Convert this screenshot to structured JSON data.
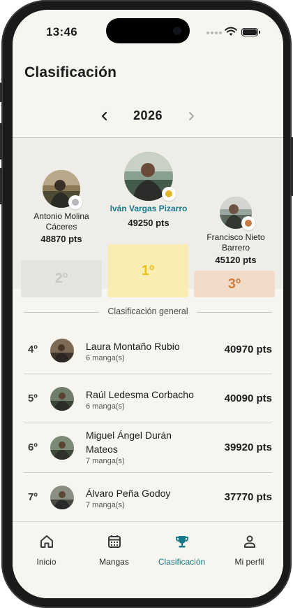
{
  "status_bar": {
    "time": "13:46"
  },
  "header": {
    "title": "Clasificación"
  },
  "year_selector": {
    "year": "2026"
  },
  "podium": [
    {
      "place_label": "2º",
      "name": "Antonio Molina Cáceres",
      "points": "48870 pts",
      "medal": "silver-medal-icon",
      "block_color": "#e6e4e0",
      "label_color": "#c9c8c4"
    },
    {
      "place_label": "1º",
      "name": "Iván Vargas Pizarro",
      "points": "49250 pts",
      "medal": "gold-medal-icon",
      "block_color": "#f9edb4",
      "label_color": "#e6c21e"
    },
    {
      "place_label": "3º",
      "name": "Francisco Nieto Barrero",
      "points": "45120 pts",
      "medal": "bronze-medal-icon",
      "block_color": "#f1dcca",
      "label_color": "#d0803c"
    }
  ],
  "general": {
    "section_title": "Clasificación general",
    "rows": [
      {
        "rank": "4º",
        "name": "Laura Montaño Rubio",
        "sub": "6 manga(s)",
        "points": "40970 pts"
      },
      {
        "rank": "5º",
        "name": "Raúl Ledesma Corbacho",
        "sub": "6 manga(s)",
        "points": "40090 pts"
      },
      {
        "rank": "6º",
        "name": "Miguel Ángel Durán Mateos",
        "sub": "7 manga(s)",
        "points": "39920 pts"
      },
      {
        "rank": "7º",
        "name": "Álvaro Peña Godoy",
        "sub": "7 manga(s)",
        "points": "37770 pts"
      }
    ]
  },
  "tabs": [
    {
      "label": "Inicio",
      "icon": "home-icon",
      "active": false
    },
    {
      "label": "Mangas",
      "icon": "calendar-icon",
      "active": false
    },
    {
      "label": "Clasificación",
      "icon": "trophy-icon",
      "active": true
    },
    {
      "label": "Mi perfil",
      "icon": "person-icon",
      "active": false
    }
  ],
  "colors": {
    "accent": "#167a8a",
    "background": "#f7f5f0",
    "podium_bg": "#efede8"
  }
}
